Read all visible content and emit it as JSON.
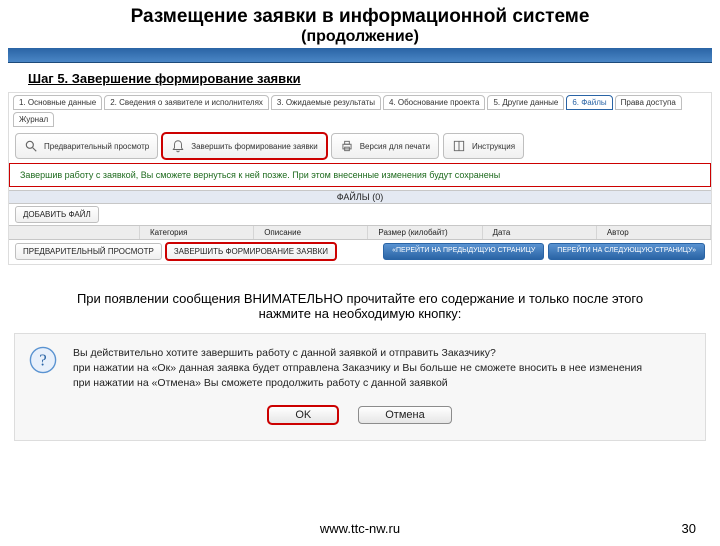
{
  "slide": {
    "title": "Размещение заявки в информационной системе",
    "subtitle": "(продолжение)",
    "step": "Шаг 5. Завершение формирование заявки"
  },
  "tabs": {
    "t1": "1. Основные данные",
    "t2": "2. Сведения о заявителе и исполнителях",
    "t3": "3. Ожидаемые результаты",
    "t4": "4. Обоснование проекта",
    "t5": "5. Другие данные",
    "t6": "6. Файлы",
    "t7": "Права доступа",
    "t8": "Журнал"
  },
  "toolbar": {
    "preview": "Предварительный просмотр",
    "finish": "Завершить формирование заявки",
    "print": "Версия для печати",
    "instr": "Инструкция"
  },
  "hint": "Завершив работу с заявкой, Вы сможете вернуться к ней позже. При этом внесенные изменения будут сохранены",
  "files": {
    "header": "ФАЙЛЫ (0)",
    "add": "ДОБАВИТЬ ФАЙЛ",
    "cols": {
      "cat": "Категория",
      "desc": "Описание",
      "size": "Размер (килобайт)",
      "date": "Дата",
      "author": "Автор"
    }
  },
  "bottom": {
    "preview": "ПРЕДВАРИТЕЛЬНЫЙ ПРОСМОТР",
    "finish": "ЗАВЕРШИТЬ ФОРМИРОВАНИЕ ЗАЯВКИ",
    "prev": "«ПЕРЕЙТИ НА ПРЕДЫДУЩУЮ СТРАНИЦУ",
    "next": "ПЕРЕЙТИ НА СЛЕДУЮЩУЮ СТРАНИЦУ»"
  },
  "instruction": "При появлении сообщения ВНИМАТЕЛЬНО прочитайте его содержание и только после этого нажмите на необходимую кнопку:",
  "dialog": {
    "line1": "Вы действительно хотите завершить работу с данной заявкой и отправить Заказчику?",
    "line2": "при нажатии на «Ок» данная заявка будет отправлена Заказчику и Вы больше не сможете вносить в нее изменения",
    "line3": "при нажатии на «Отмена» Вы сможете продолжить работу с данной заявкой",
    "ok": "OK",
    "cancel": "Отмена"
  },
  "footer": {
    "url": "www.ttc-nw.ru",
    "page": "30"
  }
}
